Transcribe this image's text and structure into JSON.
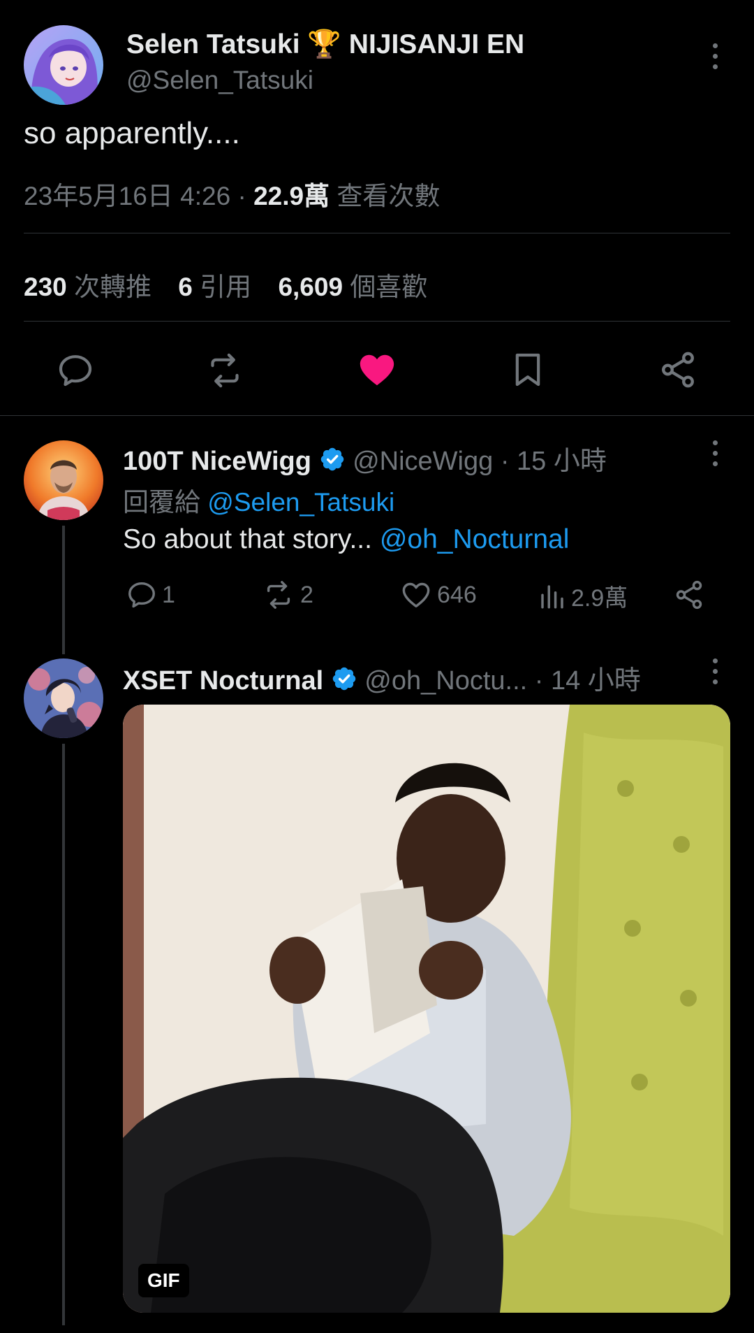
{
  "main_tweet": {
    "display_name": "Selen Tatsuki",
    "trophy": "🏆",
    "display_name_suffix": "NIJISANJI EN",
    "handle": "@Selen_Tatsuki",
    "text": "so apparently....",
    "date": "23年5月16日 4:26",
    "separator": "·",
    "views_count": "22.9萬",
    "views_label": "查看次數",
    "stats": {
      "retweets_count": "230",
      "retweets_label": "次轉推",
      "quotes_count": "6",
      "quotes_label": "引用",
      "likes_count": "6,609",
      "likes_label": "個喜歡"
    }
  },
  "reply": {
    "display_name": "100T NiceWigg",
    "handle": "@NiceWigg",
    "time": "· 15 小時",
    "reply_to_label": "回覆給",
    "reply_to_handle": "@Selen_Tatsuki",
    "text": "So about that story...",
    "mention": "@oh_Nocturnal",
    "comments": "1",
    "retweets": "2",
    "likes": "646",
    "views": "2.9萬"
  },
  "nested_reply": {
    "display_name": "XSET Nocturnal",
    "handle": "@oh_Noctu...",
    "time": "· 14 小時",
    "gif_label": "GIF"
  },
  "colors": {
    "background": "#000000",
    "text": "#e7e9ea",
    "secondary": "#71767b",
    "link": "#1d9bf0",
    "like_active": "#f91880",
    "divider": "#2f3336"
  },
  "icons": [
    "more-icon",
    "reply-icon",
    "retweet-icon",
    "heart-icon",
    "bookmark-icon",
    "share-icon",
    "verified-icon",
    "views-icon"
  ]
}
